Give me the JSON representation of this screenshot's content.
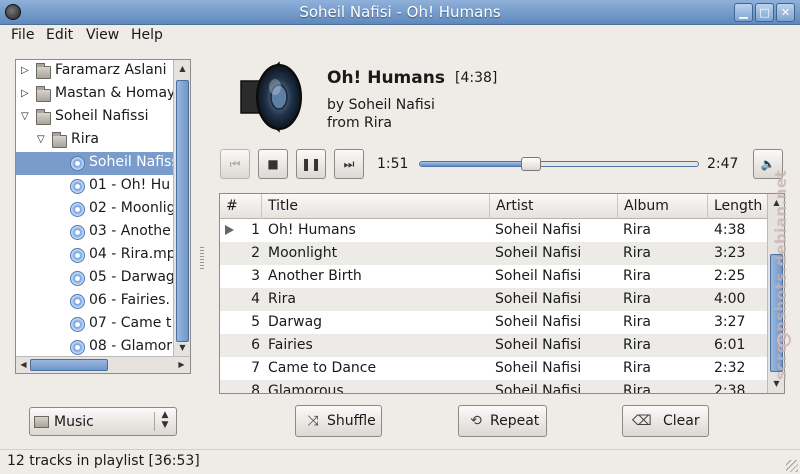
{
  "window": {
    "title": "Soheil Nafisi - Oh! Humans"
  },
  "menu": [
    "File",
    "Edit",
    "View",
    "Help"
  ],
  "tree": [
    {
      "label": "Faramarz Aslani",
      "kind": "artist",
      "expanded": false,
      "selected": false
    },
    {
      "label": "Mastan & Homay",
      "kind": "artist",
      "expanded": false,
      "selected": false
    },
    {
      "label": "Soheil Nafissi",
      "kind": "artist",
      "expanded": true,
      "selected": false
    },
    {
      "label": "Rira",
      "kind": "album",
      "expanded": true,
      "selected": false
    },
    {
      "label": "Soheil Nafiss",
      "kind": "track",
      "selected": true
    },
    {
      "label": "01 - Oh! Hu",
      "kind": "track",
      "selected": false
    },
    {
      "label": "02 - Moonlig",
      "kind": "track",
      "selected": false
    },
    {
      "label": "03 - Anothe",
      "kind": "track",
      "selected": false
    },
    {
      "label": "04 - Rira.mp",
      "kind": "track",
      "selected": false
    },
    {
      "label": "05 - Darwag",
      "kind": "track",
      "selected": false
    },
    {
      "label": "06 - Fairies.",
      "kind": "track",
      "selected": false
    },
    {
      "label": "07 - Came t",
      "kind": "track",
      "selected": false
    },
    {
      "label": "08 - Glamor",
      "kind": "track",
      "selected": false
    },
    {
      "label": "09 - Etude.n",
      "kind": "track",
      "selected": false
    }
  ],
  "now_playing": {
    "title": "Oh! Humans",
    "length": "[4:38]",
    "artist_line": "by Soheil Nafisi",
    "album_line": "from Rira",
    "cover_icon": "speaker-icon"
  },
  "transport": {
    "elapsed": "1:51",
    "remaining": "2:47",
    "progress": 0.4,
    "buttons": [
      "previous-icon",
      "stop-icon",
      "pause-icon",
      "next-icon",
      "volume-icon"
    ]
  },
  "playlist": {
    "columns": [
      "#",
      "Title",
      "Artist",
      "Album",
      "Length"
    ],
    "rows": [
      {
        "num": "1",
        "title": "Oh! Humans",
        "artist": "Soheil Nafisi",
        "album": "Rira",
        "length": "4:38",
        "playing": true
      },
      {
        "num": "2",
        "title": "Moonlight",
        "artist": "Soheil Nafisi",
        "album": "Rira",
        "length": "3:23",
        "playing": false
      },
      {
        "num": "3",
        "title": "Another Birth",
        "artist": "Soheil Nafisi",
        "album": "Rira",
        "length": "2:25",
        "playing": false
      },
      {
        "num": "4",
        "title": "Rira",
        "artist": "Soheil Nafisi",
        "album": "Rira",
        "length": "4:00",
        "playing": false
      },
      {
        "num": "5",
        "title": "Darwag",
        "artist": "Soheil Nafisi",
        "album": "Rira",
        "length": "3:27",
        "playing": false
      },
      {
        "num": "6",
        "title": "Fairies",
        "artist": "Soheil Nafisi",
        "album": "Rira",
        "length": "6:01",
        "playing": false
      },
      {
        "num": "7",
        "title": "Came to Dance",
        "artist": "Soheil Nafisi",
        "album": "Rira",
        "length": "2:32",
        "playing": false
      },
      {
        "num": "8",
        "title": "Glamorous",
        "artist": "Soheil Nafisi",
        "album": "Rira",
        "length": "2:38",
        "playing": false
      }
    ]
  },
  "source_select": {
    "value": "Music"
  },
  "buttons": {
    "shuffle": "Shuffle",
    "repeat": "Repeat",
    "clear": "Clear"
  },
  "status": {
    "text": "12 tracks in playlist  [36:53]"
  },
  "watermark": "screenshots.debian.net"
}
